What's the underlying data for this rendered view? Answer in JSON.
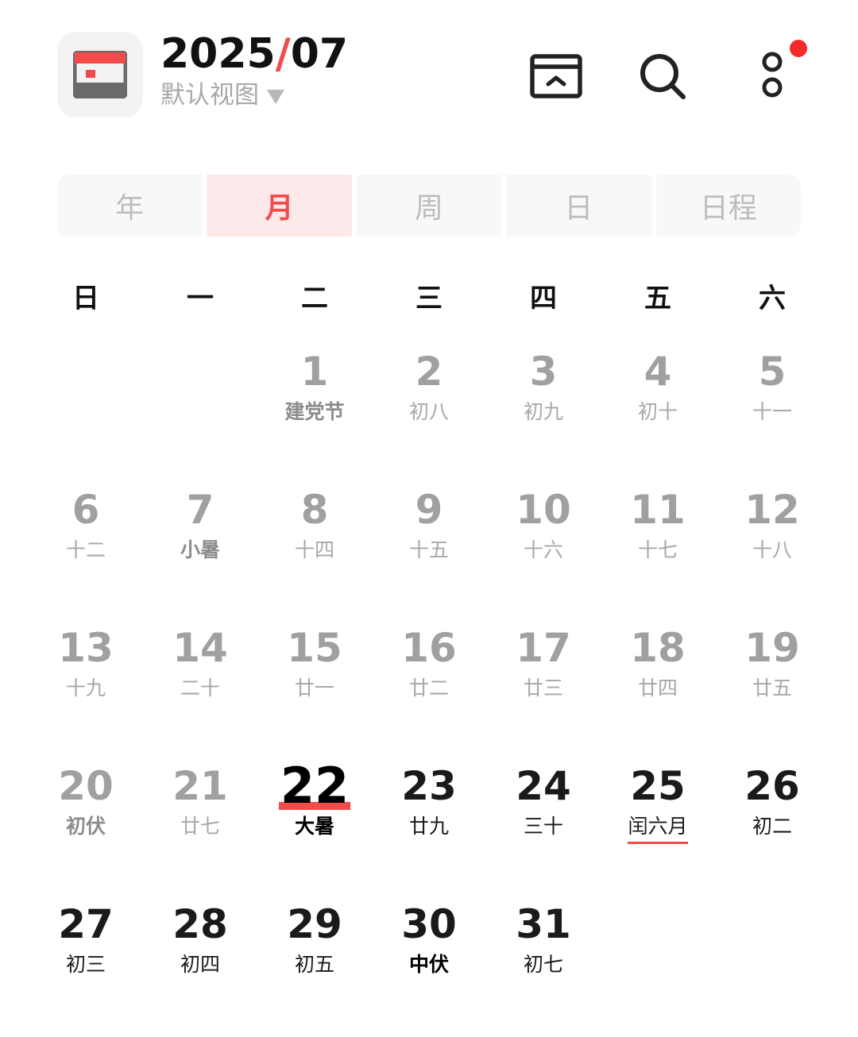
{
  "header": {
    "year": "2025",
    "slash": "/",
    "month": "07",
    "view_label": "默认视图"
  },
  "tabs": [
    {
      "label": "年"
    },
    {
      "label": "月"
    },
    {
      "label": "周"
    },
    {
      "label": "日"
    },
    {
      "label": "日程"
    }
  ],
  "weekdays": [
    "日",
    "一",
    "二",
    "三",
    "四",
    "五",
    "六"
  ],
  "colors": {
    "accent": "#f24b4b",
    "notification": "#f42a2a"
  },
  "weeks": [
    [
      {
        "day": "",
        "lunar": ""
      },
      {
        "day": "",
        "lunar": ""
      },
      {
        "day": "1",
        "lunar": "建党节"
      },
      {
        "day": "2",
        "lunar": "初八"
      },
      {
        "day": "3",
        "lunar": "初九"
      },
      {
        "day": "4",
        "lunar": "初十"
      },
      {
        "day": "5",
        "lunar": "十一"
      }
    ],
    [
      {
        "day": "6",
        "lunar": "十二"
      },
      {
        "day": "7",
        "lunar": "小暑"
      },
      {
        "day": "8",
        "lunar": "十四"
      },
      {
        "day": "9",
        "lunar": "十五"
      },
      {
        "day": "10",
        "lunar": "十六"
      },
      {
        "day": "11",
        "lunar": "十七"
      },
      {
        "day": "12",
        "lunar": "十八"
      }
    ],
    [
      {
        "day": "13",
        "lunar": "十九"
      },
      {
        "day": "14",
        "lunar": "二十"
      },
      {
        "day": "15",
        "lunar": "廿一"
      },
      {
        "day": "16",
        "lunar": "廿二"
      },
      {
        "day": "17",
        "lunar": "廿三"
      },
      {
        "day": "18",
        "lunar": "廿四"
      },
      {
        "day": "19",
        "lunar": "廿五"
      }
    ],
    [
      {
        "day": "20",
        "lunar": "初伏"
      },
      {
        "day": "21",
        "lunar": "廿七"
      },
      {
        "day": "22",
        "lunar": "大暑"
      },
      {
        "day": "23",
        "lunar": "廿九"
      },
      {
        "day": "24",
        "lunar": "三十"
      },
      {
        "day": "25",
        "lunar": "闰六月"
      },
      {
        "day": "26",
        "lunar": "初二"
      }
    ],
    [
      {
        "day": "27",
        "lunar": "初三"
      },
      {
        "day": "28",
        "lunar": "初四"
      },
      {
        "day": "29",
        "lunar": "初五"
      },
      {
        "day": "30",
        "lunar": "中伏"
      },
      {
        "day": "31",
        "lunar": "初七"
      },
      {
        "day": "",
        "lunar": ""
      },
      {
        "day": "",
        "lunar": ""
      }
    ]
  ]
}
